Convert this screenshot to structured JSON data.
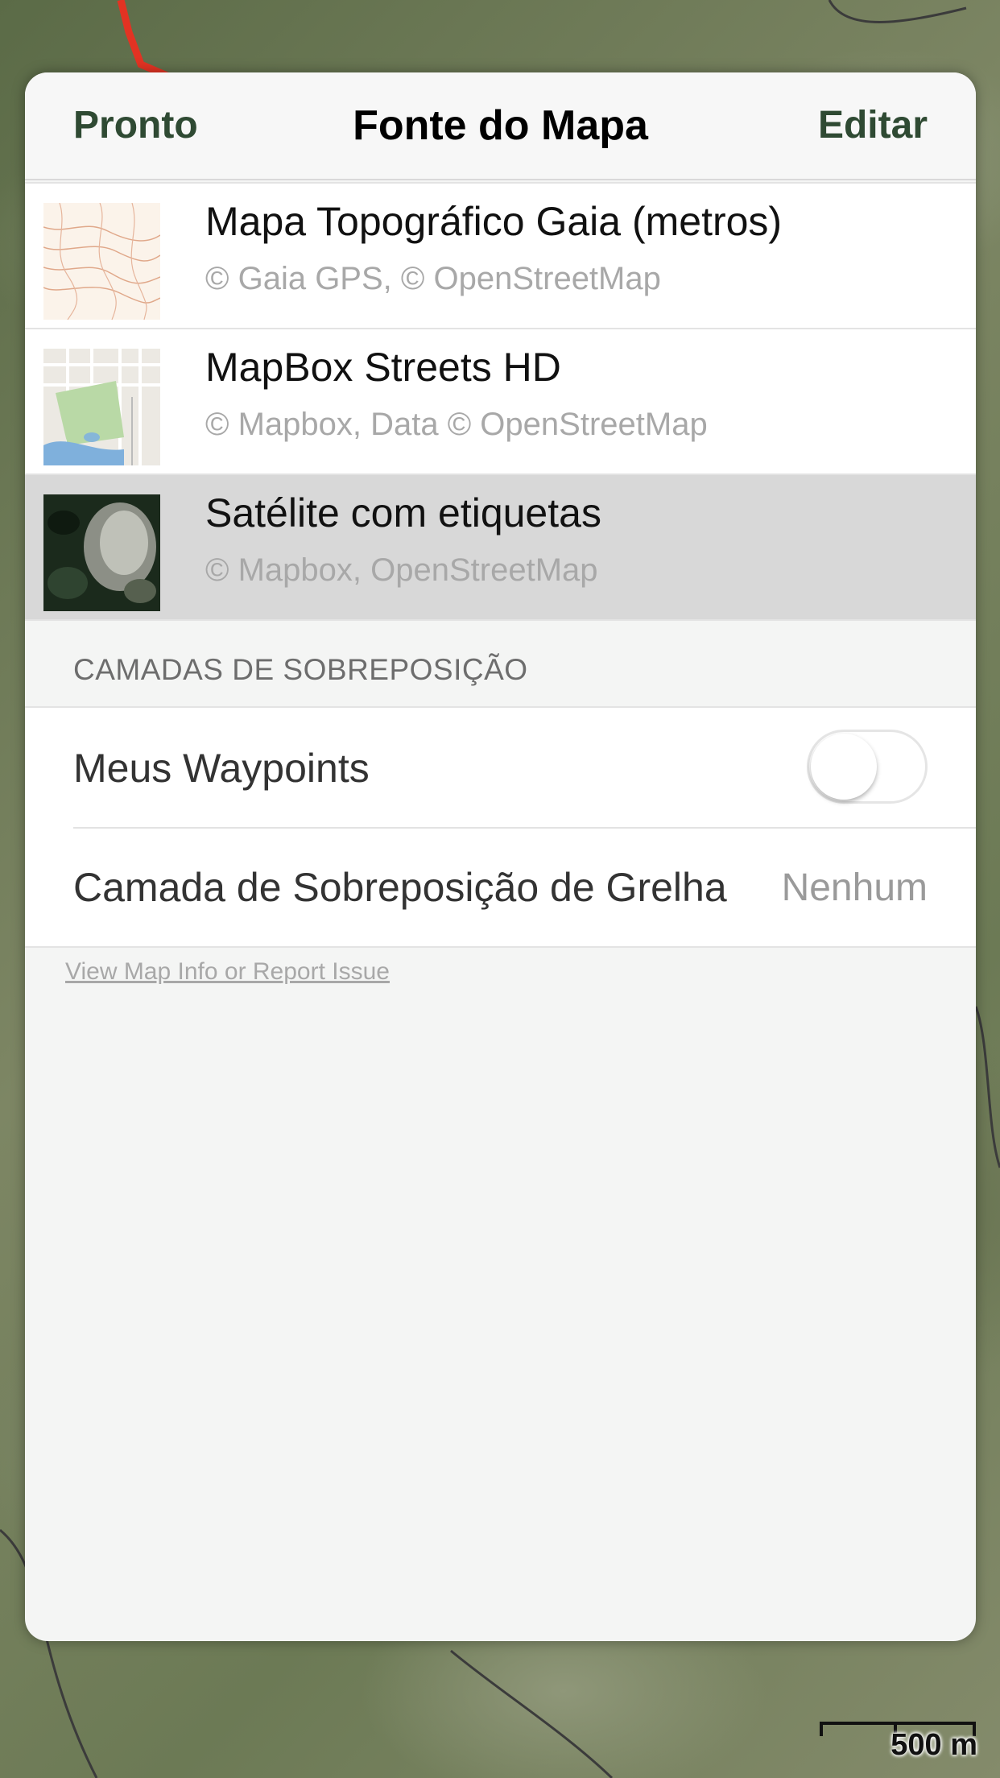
{
  "nav": {
    "done_label": "Pronto",
    "title": "Fonte do Mapa",
    "edit_label": "Editar"
  },
  "sources": [
    {
      "title": "Mapa Topográfico Gaia (metros)",
      "subtitle": "© Gaia GPS, © OpenStreetMap",
      "thumb": "topo-map-thumbnail",
      "selected": false
    },
    {
      "title": "MapBox Streets HD",
      "subtitle": "© Mapbox, Data © OpenStreetMap",
      "thumb": "streets-map-thumbnail",
      "selected": false
    },
    {
      "title": "Satélite com etiquetas",
      "subtitle": "© Mapbox, OpenStreetMap",
      "thumb": "satellite-map-thumbnail",
      "selected": true
    }
  ],
  "overlays": {
    "header": "CAMADAS DE SOBREPOSIÇÃO",
    "waypoints_label": "Meus Waypoints",
    "waypoints_on": false,
    "grid_label": "Camada de Sobreposição de Grelha",
    "grid_value": "Nenhum"
  },
  "footer_link": "View Map Info or Report Issue",
  "scale": "500 m",
  "colors": {
    "accent": "#2f4a33",
    "selected_row": "#d8d8d8",
    "subtitle": "#a8a8a8"
  }
}
